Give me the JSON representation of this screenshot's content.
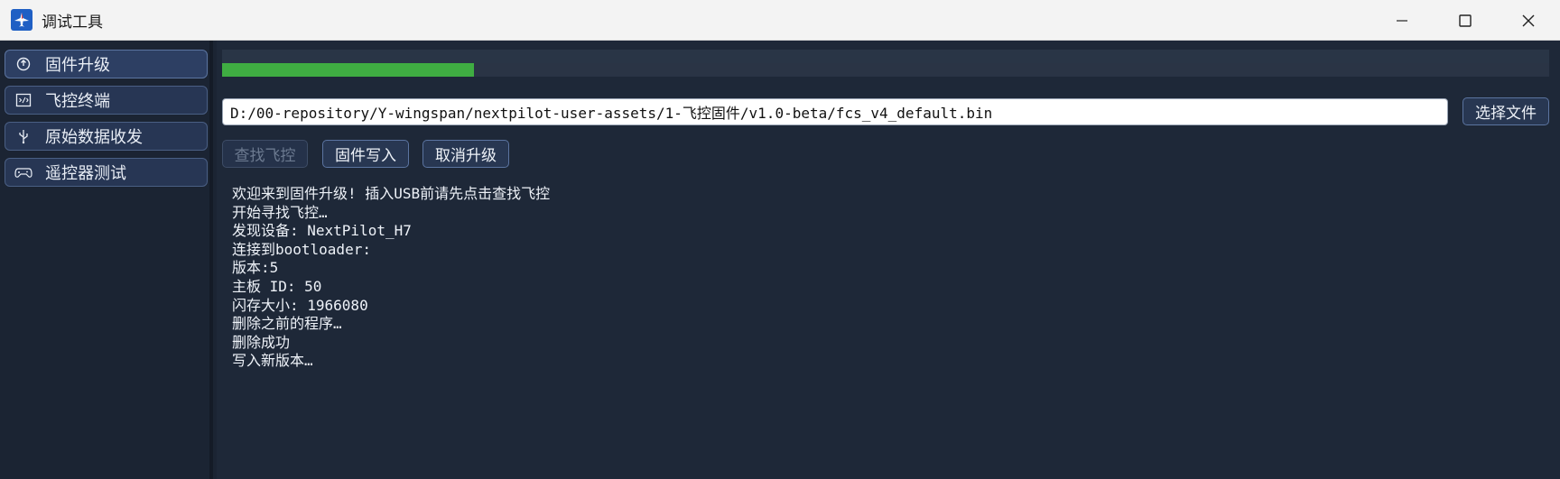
{
  "window": {
    "title": "调试工具",
    "icon": "airplane-app-icon",
    "controls": [
      "minimize-icon",
      "maximize-icon",
      "close-icon"
    ]
  },
  "sidebar": {
    "items": [
      {
        "label": "固件升级",
        "icon": "upgrade-icon",
        "active": true
      },
      {
        "label": "飞控终端",
        "icon": "terminal-icon",
        "active": false
      },
      {
        "label": "原始数据收发",
        "icon": "usb-icon",
        "active": false
      },
      {
        "label": "遥控器测试",
        "icon": "gamepad-icon",
        "active": false
      }
    ]
  },
  "main": {
    "progress": 0.19,
    "file_path": "D:/00-repository/Y-wingspan/nextpilot-user-assets/1-飞控固件/v1.0-beta/fcs_v4_default.bin",
    "select_file_label": "选择文件",
    "find_label": "查找飞控",
    "write_label": "固件写入",
    "cancel_label": "取消升级",
    "log": [
      "欢迎来到固件升级! 插入USB前请先点击查找飞控",
      "开始寻找飞控…",
      "发现设备: NextPilot_H7",
      "连接到bootloader:",
      "版本:5",
      "主板 ID: 50",
      "闪存大小: 1966080",
      "删除之前的程序…",
      "删除成功",
      "写入新版本…"
    ]
  },
  "colors": {
    "accent": "#3fad42",
    "panel": "#1e2838",
    "button": "#283752"
  }
}
